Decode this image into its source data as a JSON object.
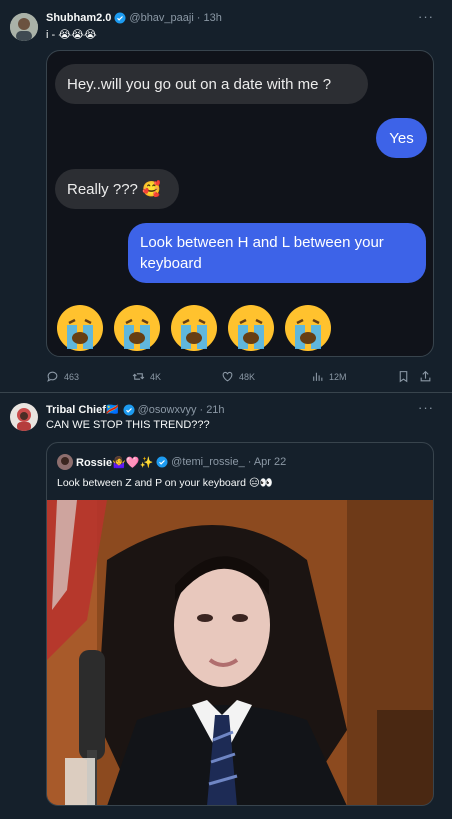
{
  "tweet1": {
    "display_name": "Shubham2.0",
    "handle": "@bhav_paaji",
    "time": "· 13h",
    "text": "i - 😭😭😭",
    "chat": {
      "msg1": "Hey..will you go out on a date with me ?",
      "msg2": "Yes",
      "msg3": "Really ??? 🥰",
      "msg4_line1": "Look between H and L between your",
      "msg4_line2": "keyboard"
    },
    "stats": {
      "replies": "463",
      "retweets": "4K",
      "likes": "48K",
      "views": "12M"
    }
  },
  "tweet2": {
    "display_name": "Tribal Chief🇨🇩",
    "handle": "@osowxvyy",
    "time": "· 21h",
    "text": "CAN WE STOP THIS TREND???",
    "quote": {
      "display_name": "Rossie🤷‍♀️🩷✨",
      "handle": "@temi_rossie_",
      "time": "· Apr 22",
      "text": "Look between Z and P on your keyboard 😑👀"
    }
  },
  "colors": {
    "bg": "#15202b",
    "accent_blue": "#3d63e8",
    "verified": "#1d9bf0",
    "muted": "#8b98a5"
  },
  "icons": [
    "more-icon",
    "reply-icon",
    "retweet-icon",
    "like-icon",
    "views-icon",
    "bookmark-icon",
    "share-icon",
    "verified-icon"
  ]
}
